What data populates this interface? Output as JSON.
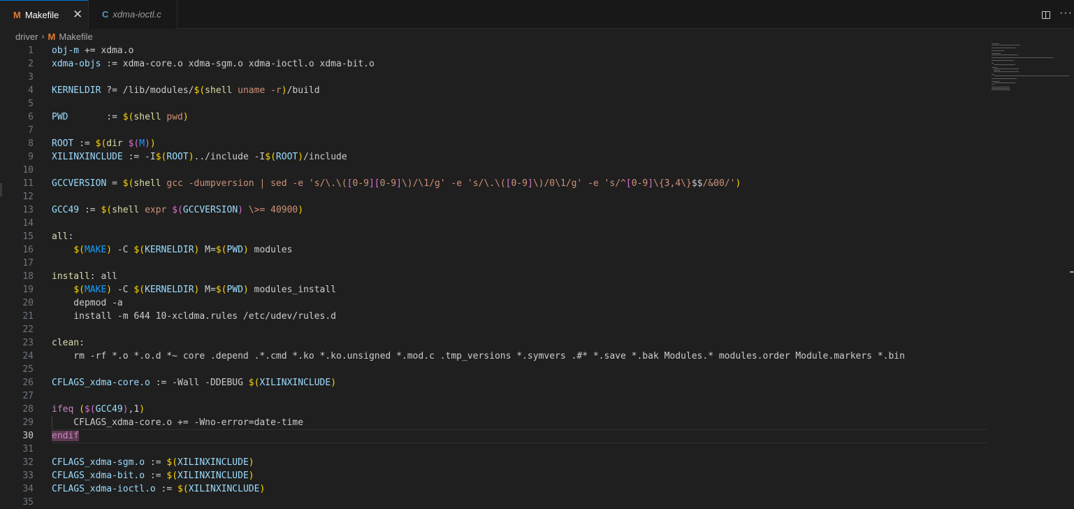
{
  "tabs": [
    {
      "icon": "M",
      "label": "Makefile",
      "close": "✕",
      "active": true
    },
    {
      "icon": "C",
      "label": "xdma-ioctl.c",
      "active": false
    }
  ],
  "breadcrumb": {
    "folder": "driver",
    "sep": "›",
    "icon": "M",
    "file": "Makefile"
  },
  "actions": {
    "more": "···"
  },
  "editor": {
    "current_line": 30,
    "lines": [
      {
        "n": "1",
        "t": [
          [
            "v",
            "obj-m"
          ],
          [
            "c",
            " += xdma.o"
          ]
        ]
      },
      {
        "n": "2",
        "t": [
          [
            "v",
            "xdma-objs"
          ],
          [
            "c",
            " := xdma-core.o xdma-sgm.o xdma-ioctl.o xdma-bit.o"
          ]
        ]
      },
      {
        "n": "3",
        "t": []
      },
      {
        "n": "4",
        "t": [
          [
            "v",
            "KERNELDIR"
          ],
          [
            "c",
            " ?= /lib/modules/"
          ],
          [
            "y",
            "$("
          ],
          [
            "f",
            "shell"
          ],
          [
            "o",
            " uname -r"
          ],
          [
            "y",
            ")"
          ],
          [
            "c",
            "/build"
          ]
        ]
      },
      {
        "n": "5",
        "t": []
      },
      {
        "n": "6",
        "t": [
          [
            "v",
            "PWD"
          ],
          [
            "c",
            "       := "
          ],
          [
            "y",
            "$("
          ],
          [
            "f",
            "shell"
          ],
          [
            "o",
            " pwd"
          ],
          [
            "y",
            ")"
          ]
        ]
      },
      {
        "n": "7",
        "t": []
      },
      {
        "n": "8",
        "t": [
          [
            "v",
            "ROOT"
          ],
          [
            "c",
            " := "
          ],
          [
            "y",
            "$("
          ],
          [
            "f",
            "dir"
          ],
          [
            "c",
            " "
          ],
          [
            "p",
            "$("
          ],
          [
            "b",
            "M"
          ],
          [
            "p",
            ")"
          ],
          [
            "y",
            ")"
          ]
        ]
      },
      {
        "n": "9",
        "t": [
          [
            "v",
            "XILINXINCLUDE"
          ],
          [
            "c",
            " := -I"
          ],
          [
            "y",
            "$("
          ],
          [
            "v",
            "ROOT"
          ],
          [
            "y",
            ")"
          ],
          [
            "c",
            "../include -I"
          ],
          [
            "y",
            "$("
          ],
          [
            "v",
            "ROOT"
          ],
          [
            "y",
            ")"
          ],
          [
            "c",
            "/include"
          ]
        ]
      },
      {
        "n": "10",
        "t": []
      },
      {
        "n": "11",
        "t": [
          [
            "v",
            "GCCVERSION"
          ],
          [
            "c",
            " = "
          ],
          [
            "y",
            "$("
          ],
          [
            "f",
            "shell"
          ],
          [
            "o",
            " gcc -dumpversion | sed -e 's/\\.\\("
          ],
          [
            "p",
            "["
          ],
          [
            "o",
            "0-9"
          ],
          [
            "p",
            "]["
          ],
          [
            "o",
            "0-9"
          ],
          [
            "p",
            "]"
          ],
          [
            "o",
            "\\)/\\1/g' -e 's/\\.\\("
          ],
          [
            "p",
            "["
          ],
          [
            "o",
            "0-9"
          ],
          [
            "p",
            "]"
          ],
          [
            "o",
            "\\)/0\\1/g' -e 's/^"
          ],
          [
            "p",
            "["
          ],
          [
            "o",
            "0-9"
          ],
          [
            "p",
            "]"
          ],
          [
            "o",
            "\\{3,4\\}"
          ],
          [
            "c",
            "$$"
          ],
          [
            "o",
            "/&00/'"
          ],
          [
            "y",
            ")"
          ]
        ]
      },
      {
        "n": "12",
        "t": []
      },
      {
        "n": "13",
        "t": [
          [
            "v",
            "GCC49"
          ],
          [
            "c",
            " := "
          ],
          [
            "y",
            "$("
          ],
          [
            "f",
            "shell"
          ],
          [
            "o",
            " expr "
          ],
          [
            "p",
            "$("
          ],
          [
            "v",
            "GCCVERSION"
          ],
          [
            "p",
            ")"
          ],
          [
            "o",
            " \\>= 40900"
          ],
          [
            "y",
            ")"
          ]
        ]
      },
      {
        "n": "14",
        "t": []
      },
      {
        "n": "15",
        "t": [
          [
            "f",
            "all"
          ],
          [
            "c",
            ":"
          ]
        ]
      },
      {
        "n": "16",
        "t": [
          [
            "c",
            "    "
          ],
          [
            "y",
            "$("
          ],
          [
            "b",
            "MAKE"
          ],
          [
            "y",
            ")"
          ],
          [
            "c",
            " -C "
          ],
          [
            "y",
            "$("
          ],
          [
            "v",
            "KERNELDIR"
          ],
          [
            "y",
            ")"
          ],
          [
            "c",
            " M="
          ],
          [
            "y",
            "$("
          ],
          [
            "v",
            "PWD"
          ],
          [
            "y",
            ")"
          ],
          [
            "c",
            " modules"
          ]
        ]
      },
      {
        "n": "17",
        "t": []
      },
      {
        "n": "18",
        "t": [
          [
            "f",
            "install"
          ],
          [
            "c",
            ": all"
          ]
        ]
      },
      {
        "n": "19",
        "t": [
          [
            "c",
            "    "
          ],
          [
            "y",
            "$("
          ],
          [
            "b",
            "MAKE"
          ],
          [
            "y",
            ")"
          ],
          [
            "c",
            " -C "
          ],
          [
            "y",
            "$("
          ],
          [
            "v",
            "KERNELDIR"
          ],
          [
            "y",
            ")"
          ],
          [
            "c",
            " M="
          ],
          [
            "y",
            "$("
          ],
          [
            "v",
            "PWD"
          ],
          [
            "y",
            ")"
          ],
          [
            "c",
            " modules_install"
          ]
        ]
      },
      {
        "n": "20",
        "t": [
          [
            "c",
            "    depmod -a"
          ]
        ]
      },
      {
        "n": "21",
        "t": [
          [
            "c",
            "    install -m 644 10-xcldma.rules /etc/udev/rules.d"
          ]
        ]
      },
      {
        "n": "22",
        "t": []
      },
      {
        "n": "23",
        "t": [
          [
            "f",
            "clean"
          ],
          [
            "c",
            ":"
          ]
        ]
      },
      {
        "n": "24",
        "t": [
          [
            "c",
            "    rm -rf *.o *.o.d *~ core .depend .*.cmd *.ko *.ko.unsigned *.mod.c .tmp_versions *.symvers .#* *.save *.bak Modules.* modules.order Module.markers *.bin"
          ]
        ]
      },
      {
        "n": "25",
        "t": []
      },
      {
        "n": "26",
        "t": [
          [
            "v",
            "CFLAGS_xdma-core.o"
          ],
          [
            "c",
            " := -Wall -DDEBUG "
          ],
          [
            "y",
            "$("
          ],
          [
            "v",
            "XILINXINCLUDE"
          ],
          [
            "y",
            ")"
          ]
        ]
      },
      {
        "n": "27",
        "t": []
      },
      {
        "n": "28",
        "t": [
          [
            "k",
            "ifeq"
          ],
          [
            "c",
            " "
          ],
          [
            "y",
            "("
          ],
          [
            "p",
            "$("
          ],
          [
            "v",
            "GCC49"
          ],
          [
            "p",
            ")"
          ],
          [
            "c",
            ",1"
          ],
          [
            "y",
            ")"
          ]
        ]
      },
      {
        "n": "29",
        "t": [
          [
            "c",
            "    CFLAGS_xdma-core.o += -Wno-error=date-time"
          ]
        ]
      },
      {
        "n": "30",
        "t": [
          [
            "k hl",
            "endif"
          ]
        ]
      },
      {
        "n": "31",
        "t": []
      },
      {
        "n": "32",
        "t": [
          [
            "v",
            "CFLAGS_xdma-sgm.o"
          ],
          [
            "c",
            " := "
          ],
          [
            "y",
            "$("
          ],
          [
            "v",
            "XILINXINCLUDE"
          ],
          [
            "y",
            ")"
          ]
        ]
      },
      {
        "n": "33",
        "t": [
          [
            "v",
            "CFLAGS_xdma-bit.o"
          ],
          [
            "c",
            " := "
          ],
          [
            "y",
            "$("
          ],
          [
            "v",
            "XILINXINCLUDE"
          ],
          [
            "y",
            ")"
          ]
        ]
      },
      {
        "n": "34",
        "t": [
          [
            "v",
            "CFLAGS_xdma-ioctl.o"
          ],
          [
            "c",
            " := "
          ],
          [
            "y",
            "$("
          ],
          [
            "v",
            "XILINXINCLUDE"
          ],
          [
            "y",
            ")"
          ]
        ]
      },
      {
        "n": "35",
        "t": []
      }
    ]
  }
}
